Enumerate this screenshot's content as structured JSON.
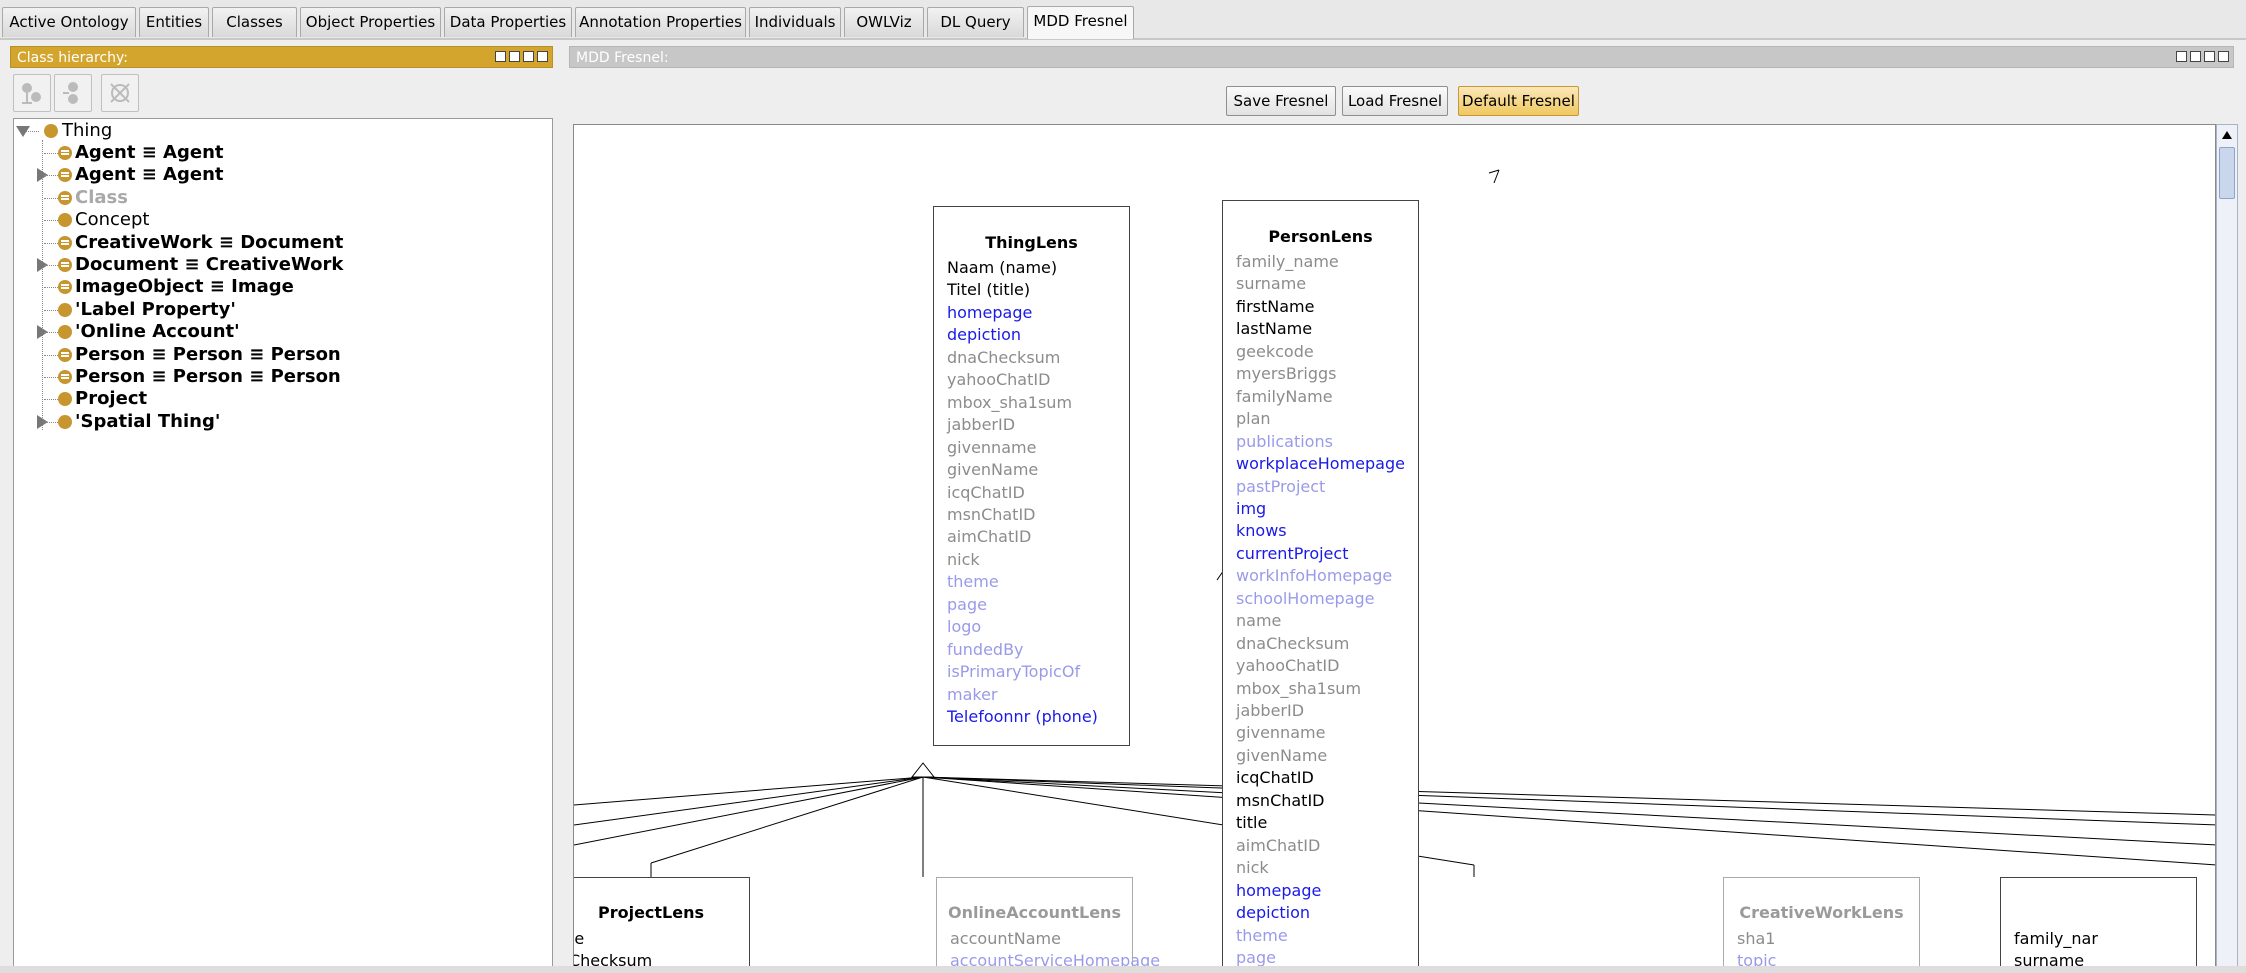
{
  "colors": {
    "accent": "#d4a52c",
    "class_dot": "#c8962e",
    "link_blue": "#1a1ae8",
    "link_light": "#9a9aea",
    "grey_text": "#8c8c8c"
  },
  "tabs": [
    {
      "label": "Active Ontology"
    },
    {
      "label": "Entities"
    },
    {
      "label": "Classes"
    },
    {
      "label": "Object Properties"
    },
    {
      "label": "Data Properties"
    },
    {
      "label": "Annotation Properties"
    },
    {
      "label": "Individuals"
    },
    {
      "label": "OWLViz"
    },
    {
      "label": "DL Query"
    },
    {
      "label": "MDD Fresnel",
      "active": true
    }
  ],
  "class_hierarchy": {
    "title": "Class hierarchy:",
    "toolbar": [
      {
        "icon": "add-subclass-icon"
      },
      {
        "icon": "add-sibling-icon"
      },
      {
        "icon": "delete-class-icon"
      }
    ],
    "root": "Thing",
    "items": [
      {
        "label": "Agent ≡ Agent",
        "expandable": false,
        "style": "bold",
        "equivalent": true
      },
      {
        "label": "Agent ≡ Agent",
        "expandable": true,
        "style": "bold",
        "equivalent": true
      },
      {
        "label": "Class",
        "expandable": false,
        "style": "grey",
        "equivalent": true
      },
      {
        "label": "Concept",
        "expandable": false,
        "style": "normal",
        "equivalent": false
      },
      {
        "label": "CreativeWork ≡ Document",
        "expandable": false,
        "style": "bold",
        "equivalent": true
      },
      {
        "label": "Document ≡ CreativeWork",
        "expandable": true,
        "style": "bold",
        "equivalent": true
      },
      {
        "label": "ImageObject ≡ Image",
        "expandable": false,
        "style": "bold",
        "equivalent": true
      },
      {
        "label": "'Label Property'",
        "expandable": false,
        "style": "bold",
        "equivalent": false
      },
      {
        "label": "'Online Account'",
        "expandable": true,
        "style": "bold",
        "equivalent": false
      },
      {
        "label": "Person ≡ Person ≡ Person",
        "expandable": false,
        "style": "bold",
        "equivalent": true
      },
      {
        "label": "Person ≡ Person ≡ Person",
        "expandable": false,
        "style": "bold",
        "equivalent": true
      },
      {
        "label": "Project",
        "expandable": false,
        "style": "bold",
        "equivalent": false
      },
      {
        "label": "'Spatial Thing'",
        "expandable": true,
        "style": "bold",
        "equivalent": false
      }
    ]
  },
  "fresnel": {
    "title": "MDD Fresnel:",
    "buttons": {
      "save": "Save Fresnel",
      "load": "Load Fresnel",
      "default": "Default Fresnel"
    },
    "lenses": {
      "thing": {
        "title": "ThingLens",
        "props": [
          {
            "t": "Naam (name)",
            "c": "black"
          },
          {
            "t": "Titel (title)",
            "c": "black"
          },
          {
            "t": "homepage",
            "c": "blue"
          },
          {
            "t": "depiction",
            "c": "blue"
          },
          {
            "t": "dnaChecksum",
            "c": "grey"
          },
          {
            "t": "yahooChatID",
            "c": "grey"
          },
          {
            "t": "mbox_sha1sum",
            "c": "grey"
          },
          {
            "t": "jabberID",
            "c": "grey"
          },
          {
            "t": "givenname",
            "c": "grey"
          },
          {
            "t": "givenName",
            "c": "grey"
          },
          {
            "t": "icqChatID",
            "c": "grey"
          },
          {
            "t": "msnChatID",
            "c": "grey"
          },
          {
            "t": "aimChatID",
            "c": "grey"
          },
          {
            "t": "nick",
            "c": "grey"
          },
          {
            "t": "theme",
            "c": "light"
          },
          {
            "t": "page",
            "c": "light"
          },
          {
            "t": "logo",
            "c": "light"
          },
          {
            "t": "fundedBy",
            "c": "light"
          },
          {
            "t": "isPrimaryTopicOf",
            "c": "light"
          },
          {
            "t": "maker",
            "c": "light"
          },
          {
            "t": "Telefoonnr (phone)",
            "c": "blue"
          }
        ]
      },
      "person": {
        "title": "PersonLens",
        "props": [
          {
            "t": "family_name",
            "c": "grey"
          },
          {
            "t": "surname",
            "c": "grey"
          },
          {
            "t": "firstName",
            "c": "black"
          },
          {
            "t": "lastName",
            "c": "black"
          },
          {
            "t": "geekcode",
            "c": "grey"
          },
          {
            "t": "myersBriggs",
            "c": "grey"
          },
          {
            "t": "familyName",
            "c": "grey"
          },
          {
            "t": "plan",
            "c": "grey"
          },
          {
            "t": "publications",
            "c": "light"
          },
          {
            "t": "workplaceHomepage",
            "c": "blue"
          },
          {
            "t": "pastProject",
            "c": "light"
          },
          {
            "t": "img",
            "c": "blue"
          },
          {
            "t": "knows",
            "c": "blue"
          },
          {
            "t": "currentProject",
            "c": "blue"
          },
          {
            "t": "workInfoHomepage",
            "c": "light"
          },
          {
            "t": "schoolHomepage",
            "c": "light"
          },
          {
            "t": "name",
            "c": "grey"
          },
          {
            "t": "dnaChecksum",
            "c": "grey"
          },
          {
            "t": "yahooChatID",
            "c": "grey"
          },
          {
            "t": "mbox_sha1sum",
            "c": "grey"
          },
          {
            "t": "jabberID",
            "c": "grey"
          },
          {
            "t": "givenname",
            "c": "grey"
          },
          {
            "t": "givenName",
            "c": "grey"
          },
          {
            "t": "icqChatID",
            "c": "black"
          },
          {
            "t": "msnChatID",
            "c": "black"
          },
          {
            "t": "title",
            "c": "black"
          },
          {
            "t": "aimChatID",
            "c": "grey"
          },
          {
            "t": "nick",
            "c": "grey"
          },
          {
            "t": "homepage",
            "c": "blue"
          },
          {
            "t": "depiction",
            "c": "blue"
          },
          {
            "t": "theme",
            "c": "light"
          },
          {
            "t": "page",
            "c": "light"
          }
        ]
      },
      "project": {
        "title": "ProjectLens",
        "props": [
          {
            "t": "ame",
            "c": "black"
          },
          {
            "t": "naChecksum",
            "c": "black"
          }
        ]
      },
      "online": {
        "title": "OnlineAccountLens",
        "props": [
          {
            "t": "accountName",
            "c": "grey"
          },
          {
            "t": "accountServiceHomepage",
            "c": "light"
          }
        ]
      },
      "creative": {
        "title": "CreativeWorkLens",
        "props": [
          {
            "t": "sha1",
            "c": "grey"
          },
          {
            "t": "topic",
            "c": "light"
          }
        ]
      },
      "partial": {
        "title": "",
        "props": [
          {
            "t": "family_nar",
            "c": "black"
          },
          {
            "t": "surname",
            "c": "black"
          }
        ]
      }
    }
  }
}
